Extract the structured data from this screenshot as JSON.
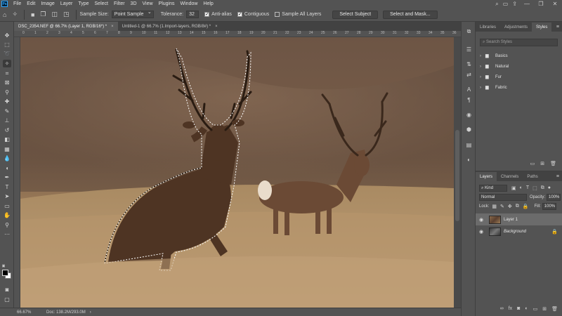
{
  "menubar": {
    "app_logo": "Ps",
    "items": [
      "File",
      "Edit",
      "Image",
      "Layer",
      "Type",
      "Select",
      "Filter",
      "3D",
      "View",
      "Plugins",
      "Window",
      "Help"
    ],
    "right_icons": [
      "search-icon",
      "workspace-icon",
      "share-icon"
    ],
    "window_controls": [
      "—",
      "❐",
      "✕"
    ]
  },
  "options": {
    "sample_size_label": "Sample Size:",
    "sample_size_value": "Point Sample",
    "tolerance_label": "Tolerance:",
    "tolerance_value": "32",
    "anti_alias": "Anti-alias",
    "contiguous": "Contiguous",
    "sample_all_layers": "Sample All Layers",
    "select_subject": "Select Subject",
    "select_and_mask": "Select and Mask..."
  },
  "tabs": [
    {
      "label": "DSC_2354.NEF @ 66.7% (Layer 1, RGB/16*) *",
      "active": true
    },
    {
      "label": "Untitled-1 @ 66.7% (1.Import-layers, RGB/8#) *",
      "active": false
    }
  ],
  "ruler": {
    "h_ticks": [
      "0",
      "1",
      "2",
      "3",
      "4",
      "5",
      "6",
      "7",
      "8",
      "9",
      "10",
      "11",
      "12",
      "13",
      "14",
      "15",
      "16",
      "17",
      "18",
      "19",
      "20",
      "21",
      "22",
      "23",
      "24",
      "25",
      "26",
      "27",
      "28",
      "29",
      "30",
      "31",
      "32",
      "33",
      "34",
      "35",
      "36"
    ]
  },
  "status": {
    "zoom": "66.67%",
    "doc": "Doc: 138.2M/293.0M",
    "arrow": "›"
  },
  "styles_panel": {
    "tabs": [
      "Libraries",
      "Adjustments",
      "Styles"
    ],
    "active_tab": "Styles",
    "search_placeholder": "Search Styles",
    "folders": [
      "Basics",
      "Natural",
      "Fur",
      "Fabric"
    ]
  },
  "layers_panel": {
    "tabs": [
      "Layers",
      "Channels",
      "Paths"
    ],
    "kind_label": "Kind",
    "blend_mode": "Normal",
    "opacity_label": "Opacity:",
    "opacity_value": "100%",
    "lock_label": "Lock:",
    "fill_label": "Fill:",
    "fill_value": "100%",
    "layers": [
      {
        "name": "Layer 1",
        "selected": true
      },
      {
        "name": "Background",
        "selected": false
      }
    ]
  },
  "colors": {
    "accent": "#31a8ff",
    "panel_bg": "#535353",
    "dark_bg": "#424242"
  }
}
